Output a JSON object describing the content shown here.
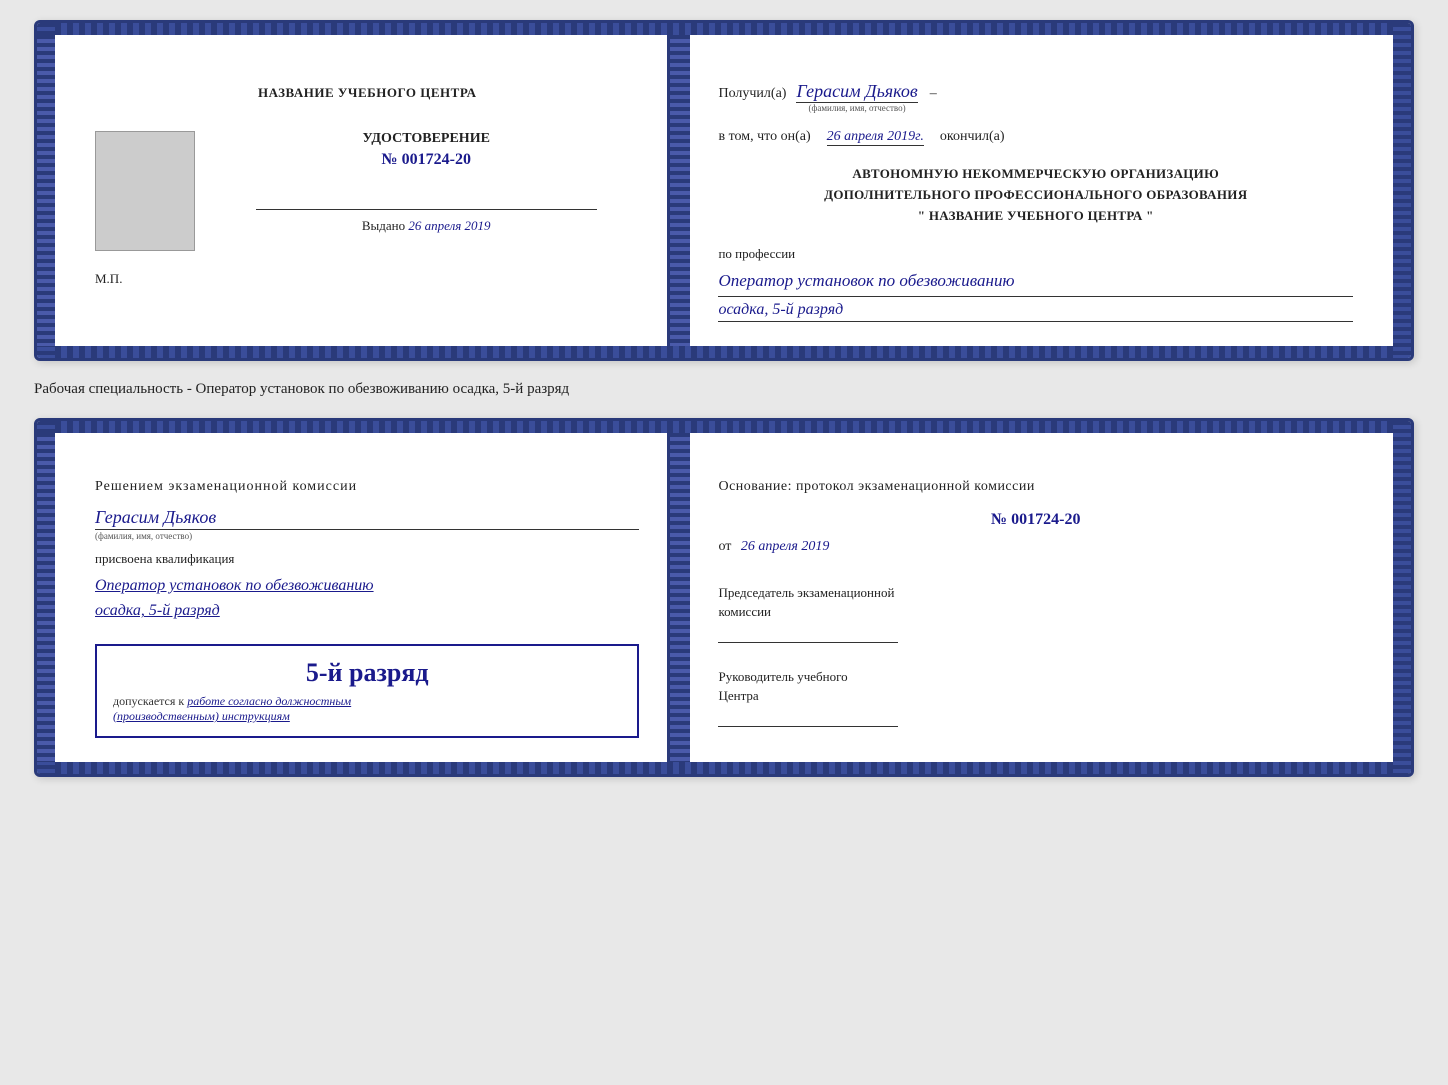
{
  "card1": {
    "left": {
      "school_name": "НАЗВАНИЕ УЧЕБНОГО ЦЕНТРА",
      "udost_title": "УДОСТОВЕРЕНИЕ",
      "udost_number": "№ 001724-20",
      "vydano_label": "Выдано",
      "vydano_date": "26 апреля 2019",
      "mp_label": "М.П."
    },
    "right": {
      "poluchil_label": "Получил(а)",
      "recipient_name": "Герасим Дьяков",
      "fio_hint": "(фамилия, имя, отчество)",
      "dash": "–",
      "v_tom_label": "в том, что он(а)",
      "date_okончил": "26 апреля 2019г.",
      "okончil_label": "окончил(а)",
      "org_line1": "АВТОНОМНУЮ НЕКОММЕРЧЕСКУЮ ОРГАНИЗАЦИЮ",
      "org_line2": "ДОПОЛНИТЕЛЬНОГО ПРОФЕССИОНАЛЬНОГО ОБРАЗОВАНИЯ",
      "org_line3": "\"   НАЗВАНИЕ УЧЕБНОГО ЦЕНТРА   \"",
      "po_professii_label": "по профессии",
      "profession": "Оператор установок по обезвоживанию",
      "rank": "осадка, 5-й разряд"
    }
  },
  "separator_label": "Рабочая специальность - Оператор установок по обезвоживанию осадка, 5-й разряд",
  "card2": {
    "left": {
      "resheniem_text": "Решением экзаменационной комиссии",
      "name": "Герасим Дьяков",
      "fio_hint": "(фамилия, имя, отчество)",
      "prisvoena_text": "присвоена квалификация",
      "qualification_line1": "Оператор установок по обезвоживанию",
      "qualification_line2": "осадка, 5-й разряд",
      "stamp_rank": "5-й разряд",
      "dopusk_label": "допускается к",
      "dopusk_text": "работе согласно должностным",
      "dopusk_text2": "(производственным) инструкциям"
    },
    "right": {
      "osnovanie_text": "Основание: протокол экзаменационной комиссии",
      "protocol_number": "№  001724-20",
      "ot_label": "от",
      "ot_date": "26 апреля 2019",
      "predsedatel_line1": "Председатель экзаменационной",
      "predsedatel_line2": "комиссии",
      "rukovoditel_line1": "Руководитель учебного",
      "rukovoditel_line2": "Центра"
    }
  }
}
